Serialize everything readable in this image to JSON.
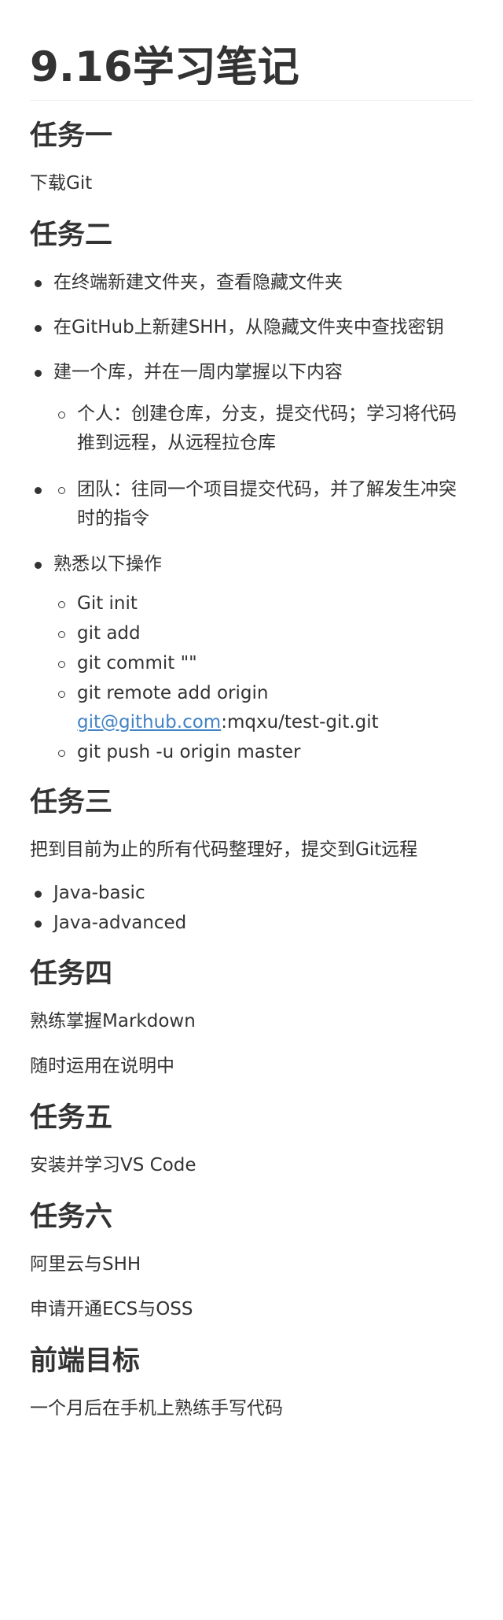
{
  "title": "9.16学习笔记",
  "task1": {
    "heading": "任务一",
    "text": "下载Git"
  },
  "task2": {
    "heading": "任务二",
    "items": [
      "在终端新建文件夹，查看隐藏文件夹",
      "在GitHub上新建SHH，从隐藏文件夹中查找密钥",
      "建一个库，并在一周内掌握以下内容"
    ],
    "sub_personal_1": "个人：创建仓库，分支，提交代码；学习将代码",
    "sub_personal_2": "推到远程，从远程拉仓库",
    "team_1": "团队：往同一个项目提交代码，并了解发生冲突",
    "team_2": "时的指令",
    "ops_label": "熟悉以下操作",
    "ops": {
      "init": "Git init",
      "add": "git add",
      "commit": "git commit \"\"",
      "remote_prefix": "git remote add origin",
      "remote_link": "git@github.com",
      "remote_suffix": ":mqxu/test-git.git",
      "push": "git push -u origin master"
    }
  },
  "task3": {
    "heading": "任务三",
    "text": "把到目前为止的所有代码整理好，提交到Git远程",
    "items": [
      "Java-basic",
      "Java-advanced"
    ]
  },
  "task4": {
    "heading": "任务四",
    "line1": "熟练掌握Markdown",
    "line2": "随时运用在说明中"
  },
  "task5": {
    "heading": "任务五",
    "text": "安装并学习VS Code"
  },
  "task6": {
    "heading": "任务六",
    "line1": "阿里云与SHH",
    "line2": "申请开通ECS与OSS"
  },
  "frontend": {
    "heading": "前端目标",
    "text": "一个月后在手机上熟练手写代码"
  }
}
